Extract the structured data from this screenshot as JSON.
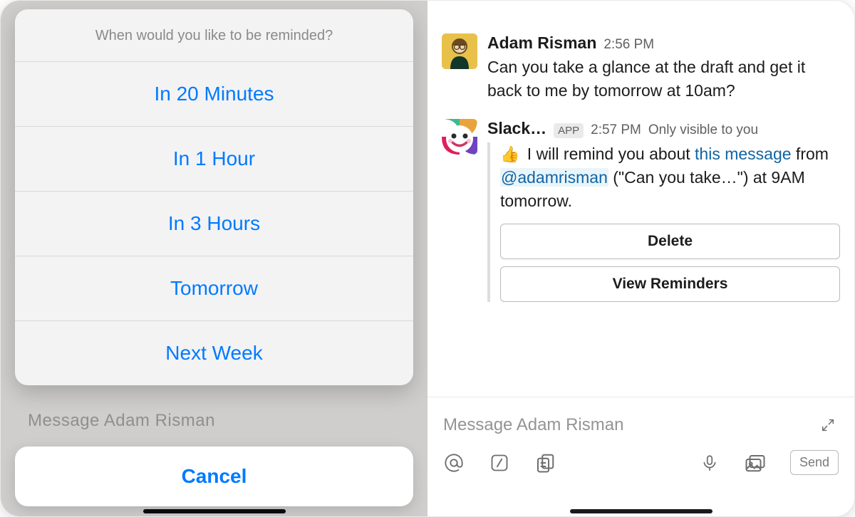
{
  "reminder_sheet": {
    "title": "When would you like to be reminded?",
    "options": [
      "In 20 Minutes",
      "In 1 Hour",
      "In 3 Hours",
      "Tomorrow",
      "Next Week"
    ],
    "cancel": "Cancel",
    "ghost_input": "Message Adam Risman"
  },
  "thread": {
    "messages": [
      {
        "author": "Adam Risman",
        "time": "2:56 PM",
        "text": "Can you take a glance at the draft and get it back to me by tomorrow at 10am?"
      },
      {
        "author": "Slack…",
        "badge": "APP",
        "time": "2:57 PM",
        "visibility": "Only visible to you",
        "emoji": "👍",
        "text_pre": " I will remind you about ",
        "link1": "this message",
        "text_mid": " from ",
        "mention": "@adamrisman",
        "text_post": " (\"Can you take…\") at 9AM tomorrow.",
        "buttons": [
          "Delete",
          "View Reminders"
        ]
      }
    ]
  },
  "composer": {
    "placeholder": "Message Adam Risman",
    "send": "Send"
  }
}
